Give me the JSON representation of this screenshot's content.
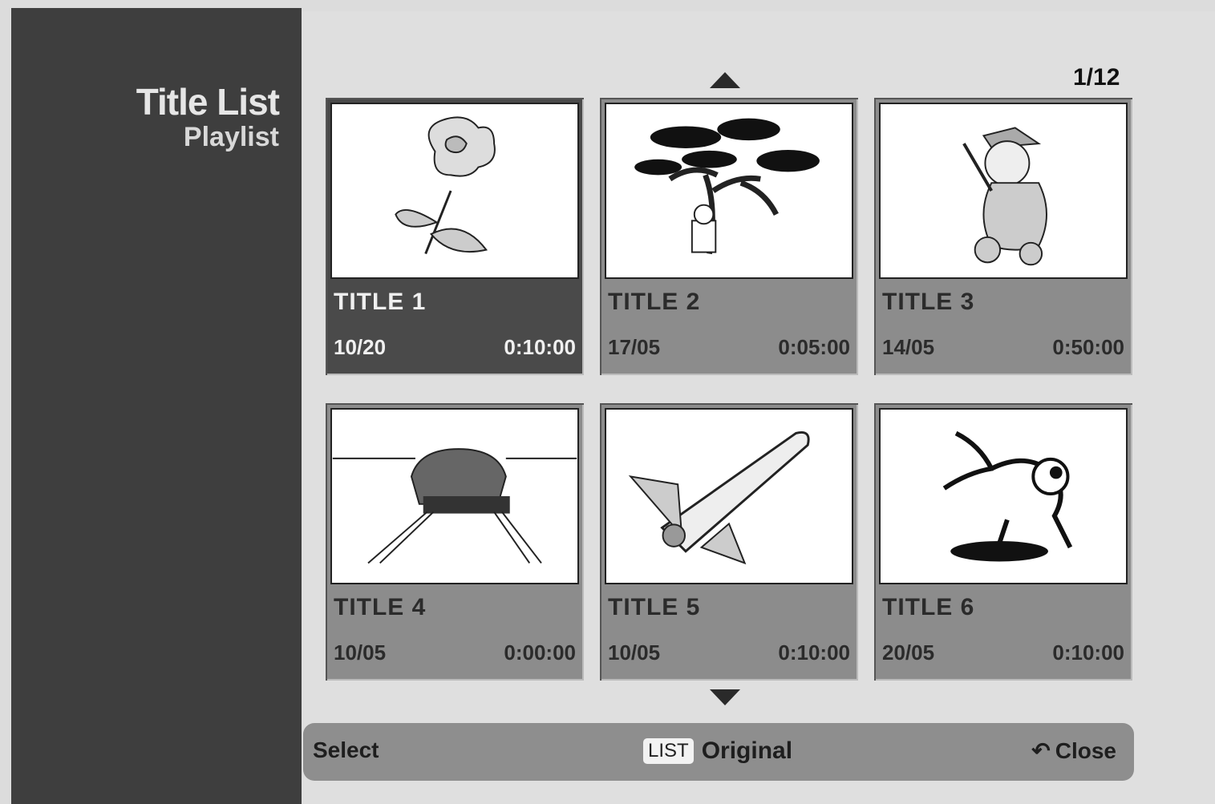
{
  "sidebar": {
    "title": "Title List",
    "subtitle": "Playlist"
  },
  "page_counter": "1/12",
  "titles": [
    {
      "name": "TITLE 1",
      "date": "10/20",
      "duration": "0:10:00",
      "selected": true
    },
    {
      "name": "TITLE 2",
      "date": "17/05",
      "duration": "0:05:00",
      "selected": false
    },
    {
      "name": "TITLE 3",
      "date": "14/05",
      "duration": "0:50:00",
      "selected": false
    },
    {
      "name": "TITLE 4",
      "date": "10/05",
      "duration": "0:00:00",
      "selected": false
    },
    {
      "name": "TITLE 5",
      "date": "10/05",
      "duration": "0:10:00",
      "selected": false
    },
    {
      "name": "TITLE 6",
      "date": "20/05",
      "duration": "0:10:00",
      "selected": false
    }
  ],
  "bottom_bar": {
    "left_label": "Select",
    "list_badge": "LIST",
    "center_label": "Original",
    "right_label": "Close"
  }
}
